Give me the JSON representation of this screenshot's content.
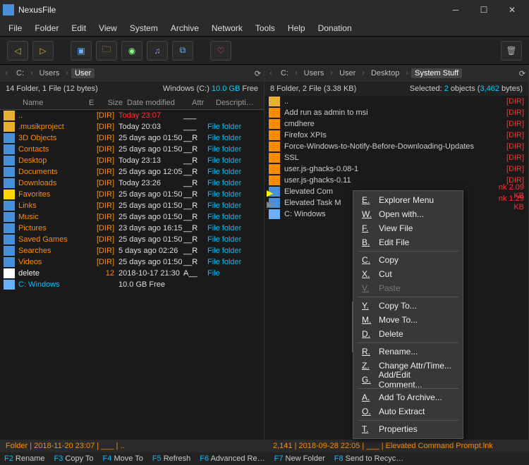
{
  "window": {
    "title": "NexusFile"
  },
  "menu": {
    "file": "File",
    "folder": "Folder",
    "edit": "Edit",
    "view": "View",
    "system": "System",
    "archive": "Archive",
    "network": "Network",
    "tools": "Tools",
    "help": "Help",
    "donation": "Donation"
  },
  "left": {
    "path": [
      "C:",
      "Users",
      "User"
    ],
    "status_left": "14 Folder, 1 File (12 bytes)",
    "status_right_pre": "Windows (C:) ",
    "status_right_cyan": "10.0 GB",
    "status_right_post": " Free",
    "headers": {
      "name": "Name",
      "e": "E",
      "size": "Size",
      "date": "Date modified",
      "attr": "Attr",
      "desc": "Descripti…"
    },
    "rows": [
      {
        "n": "..",
        "size": "[DIR]",
        "date": "Today",
        "time": "23:07",
        "attr": "___",
        "desc": "",
        "today": true,
        "cls": "orange",
        "ic": "folder-ic"
      },
      {
        "n": ".musikproject",
        "size": "[DIR]",
        "date": "Today",
        "time": "20:03",
        "attr": "___",
        "desc": "File folder",
        "cls": "orange",
        "ic": "folder-ic"
      },
      {
        "n": "3D Objects",
        "size": "[DIR]",
        "date": "25 days ago",
        "time": "01:50",
        "attr": "__R",
        "desc": "File folder",
        "cls": "orange",
        "ic": "shortcut-ic"
      },
      {
        "n": "Contacts",
        "size": "[DIR]",
        "date": "25 days ago",
        "time": "01:50",
        "attr": "__R",
        "desc": "File folder",
        "cls": "orange",
        "ic": "shortcut-ic"
      },
      {
        "n": "Desktop",
        "size": "[DIR]",
        "date": "Today",
        "time": "23:13",
        "attr": "__R",
        "desc": "File folder",
        "cls": "orange",
        "ic": "shortcut-ic"
      },
      {
        "n": "Documents",
        "size": "[DIR]",
        "date": "25 days ago",
        "time": "12:05",
        "attr": "__R",
        "desc": "File folder",
        "cls": "orange",
        "ic": "shortcut-ic"
      },
      {
        "n": "Downloads",
        "size": "[DIR]",
        "date": "Today",
        "time": "23:26",
        "attr": "__R",
        "desc": "File folder",
        "cls": "orange",
        "ic": "shortcut-ic"
      },
      {
        "n": "Favorites",
        "size": "[DIR]",
        "date": "25 days ago",
        "time": "01:50",
        "attr": "__R",
        "desc": "File folder",
        "cls": "orange",
        "ic": "star-ic"
      },
      {
        "n": "Links",
        "size": "[DIR]",
        "date": "25 days ago",
        "time": "01:50",
        "attr": "__R",
        "desc": "File folder",
        "cls": "orange",
        "ic": "shortcut-ic"
      },
      {
        "n": "Music",
        "size": "[DIR]",
        "date": "25 days ago",
        "time": "01:50",
        "attr": "__R",
        "desc": "File folder",
        "cls": "orange",
        "ic": "shortcut-ic"
      },
      {
        "n": "Pictures",
        "size": "[DIR]",
        "date": "23 days ago",
        "time": "16:15",
        "attr": "__R",
        "desc": "File folder",
        "cls": "orange",
        "ic": "shortcut-ic"
      },
      {
        "n": "Saved Games",
        "size": "[DIR]",
        "date": "25 days ago",
        "time": "01:50",
        "attr": "__R",
        "desc": "File folder",
        "cls": "orange",
        "ic": "shortcut-ic"
      },
      {
        "n": "Searches",
        "size": "[DIR]",
        "date": "5 days ago",
        "time": "02:26",
        "attr": "__R",
        "desc": "File folder",
        "cls": "orange",
        "ic": "shortcut-ic"
      },
      {
        "n": "Videos",
        "size": "[DIR]",
        "date": "25 days ago",
        "time": "01:50",
        "attr": "__R",
        "desc": "File folder",
        "cls": "orange",
        "ic": "shortcut-ic"
      },
      {
        "n": "delete",
        "size": "12",
        "date": "2018-10-17",
        "time": "21:30",
        "attr": "A__",
        "desc": "File",
        "cls": "white",
        "ic": "file-ic"
      },
      {
        "n": "C: Windows",
        "size": "",
        "date": "10.0 GB Free",
        "time": "",
        "attr": "",
        "desc": "",
        "cls": "cyan",
        "ic": "drive-ic"
      }
    ]
  },
  "right": {
    "path": [
      "C:",
      "Users",
      "User",
      "Desktop",
      "System Stuff"
    ],
    "status_left": "8 Folder, 2 File (3.38 KB)",
    "status_right_pre": "Selected: ",
    "status_cyan1": "2",
    "status_mid": " objects (",
    "status_cyan2": "3,462",
    "status_post": " bytes)",
    "rows": [
      {
        "n": "..",
        "size": "[DIR]",
        "cls": "orange",
        "ic": "folder-ic"
      },
      {
        "n": "Add run as admin to msi",
        "size": "[DIR]",
        "cls": "red",
        "ic": "orange-ic"
      },
      {
        "n": "cmdhere",
        "size": "[DIR]",
        "cls": "red",
        "ic": "orange-ic"
      },
      {
        "n": "Firefox XPIs",
        "size": "[DIR]",
        "cls": "red",
        "ic": "orange-ic"
      },
      {
        "n": "Force-Windows-to-Notify-Before-Downloading-Updates",
        "size": "[DIR]",
        "cls": "red",
        "ic": "orange-ic"
      },
      {
        "n": "SSL",
        "size": "[DIR]",
        "cls": "red",
        "ic": "orange-ic"
      },
      {
        "n": "user.js-ghacks-0.08-1",
        "size": "[DIR]",
        "cls": "red",
        "ic": "orange-ic"
      },
      {
        "n": "user.js-ghacks-0.11",
        "size": "[DIR]",
        "cls": "red",
        "ic": "orange-ic"
      },
      {
        "n": "Elevated Com",
        "size": "nk   2.09 KB",
        "cls": "sel1",
        "ic": "shortcut-ic"
      },
      {
        "n": "Elevated Task M",
        "size": "nk   1.29 KB",
        "cls": "sel2",
        "ic": "shortcut-ic"
      },
      {
        "n": "C: Windows",
        "size": "",
        "cls": "cyan",
        "ic": "drive-ic"
      }
    ]
  },
  "context": {
    "items": [
      {
        "k": "E.",
        "t": "Explorer Menu"
      },
      {
        "k": "W.",
        "t": "Open with..."
      },
      {
        "k": "F.",
        "t": "View File"
      },
      {
        "k": "B.",
        "t": "Edit File"
      },
      {
        "sep": true
      },
      {
        "k": "C.",
        "t": "Copy"
      },
      {
        "k": "X.",
        "t": "Cut"
      },
      {
        "k": "V.",
        "t": "Paste",
        "disabled": true
      },
      {
        "sep": true
      },
      {
        "k": "Y.",
        "t": "Copy To..."
      },
      {
        "k": "M.",
        "t": "Move To..."
      },
      {
        "k": "D.",
        "t": "Delete"
      },
      {
        "sep": true
      },
      {
        "k": "R.",
        "t": "Rename..."
      },
      {
        "k": "Z.",
        "t": "Change Attr/Time..."
      },
      {
        "k": "G.",
        "t": "Add/Edit Comment..."
      },
      {
        "sep": true
      },
      {
        "k": "A.",
        "t": "Add To Archive..."
      },
      {
        "k": "O.",
        "t": "Auto Extract"
      },
      {
        "sep": true
      },
      {
        "k": "T.",
        "t": "Properties"
      }
    ]
  },
  "footer1": {
    "left": "Folder  |  2018-11-20 23:07  |  ___  |  ..",
    "right": "2,141  |  2018-09-28 22:05  |  ___  |  Elevated Command Prompt.lnk"
  },
  "footer2": [
    {
      "k": "F2",
      "t": "Rename"
    },
    {
      "k": "F3",
      "t": "Copy To"
    },
    {
      "k": "F4",
      "t": "Move To"
    },
    {
      "k": "F5",
      "t": "Refresh"
    },
    {
      "k": "F6",
      "t": "Advanced Re…"
    },
    {
      "k": "F7",
      "t": "New Folder"
    },
    {
      "k": "F8",
      "t": "Send to Recyc…"
    }
  ]
}
